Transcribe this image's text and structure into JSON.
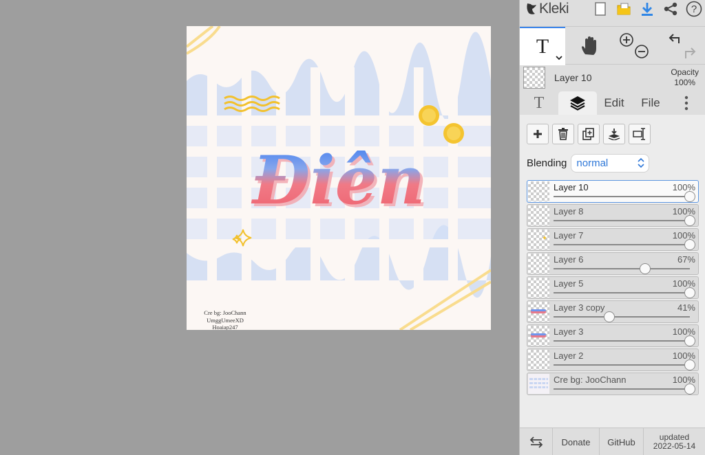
{
  "app": {
    "logo_text": "Kleki"
  },
  "canvas": {
    "artwork_text": "Điên",
    "credit_lines": [
      "Cre bg: JooChann",
      "UmggUmeeXD",
      "Hoaiap247"
    ]
  },
  "current_layer": {
    "name": "Layer 10",
    "opacity_label": "Opacity",
    "opacity_value": "100%"
  },
  "tabs": {
    "edit": "Edit",
    "file": "File",
    "text_tab": "T"
  },
  "tools": {
    "text_tool": "T"
  },
  "blending": {
    "label": "Blending",
    "value": "normal"
  },
  "layers": [
    {
      "name": "Layer 10",
      "opacity": "100%",
      "level": 1.0,
      "selected": true,
      "thumb": "empty"
    },
    {
      "name": "Layer 8",
      "opacity": "100%",
      "level": 1.0,
      "selected": false,
      "thumb": "empty"
    },
    {
      "name": "Layer 7",
      "opacity": "100%",
      "level": 1.0,
      "selected": false,
      "thumb": "sparkle"
    },
    {
      "name": "Layer 6",
      "opacity": "67%",
      "level": 0.67,
      "selected": false,
      "thumb": "empty"
    },
    {
      "name": "Layer 5",
      "opacity": "100%",
      "level": 1.0,
      "selected": false,
      "thumb": "empty"
    },
    {
      "name": "Layer 3 copy",
      "opacity": "41%",
      "level": 0.41,
      "selected": false,
      "thumb": "text"
    },
    {
      "name": "Layer 3",
      "opacity": "100%",
      "level": 1.0,
      "selected": false,
      "thumb": "text"
    },
    {
      "name": "Layer 2",
      "opacity": "100%",
      "level": 1.0,
      "selected": false,
      "thumb": "empty"
    },
    {
      "name": "Cre bg: JooChann",
      "opacity": "100%",
      "level": 1.0,
      "selected": false,
      "thumb": "grid"
    }
  ],
  "footer": {
    "donate": "Donate",
    "github": "GitHub",
    "updated_label": "updated",
    "updated_date": "2022-05-14"
  },
  "colors": {
    "accent": "#3b85ea",
    "blend_text": "#2f78d8",
    "workspace": "#9e9e9e",
    "panel": "#ececec"
  },
  "icons": [
    "new-file-icon",
    "open-folder-icon",
    "download-icon",
    "share-icon",
    "help-icon",
    "hand-icon",
    "zoom-in-icon",
    "zoom-out-icon",
    "undo-icon",
    "redo-icon",
    "layers-icon",
    "more-icon",
    "add-layer-icon",
    "delete-layer-icon",
    "duplicate-layer-icon",
    "merge-down-icon",
    "rename-layer-icon",
    "swap-sides-icon"
  ]
}
